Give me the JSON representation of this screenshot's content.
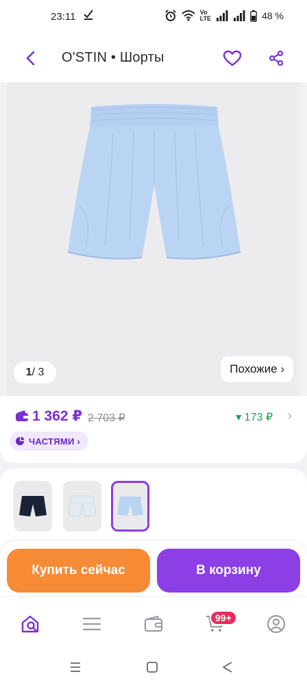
{
  "status_bar": {
    "time": "23:11",
    "check_icon": "check-download-icon",
    "battery_percent": "48 %",
    "network_label_top": "Vo",
    "network_label_bottom": "LTE"
  },
  "header": {
    "title": "O'STIN • Шорты",
    "back_icon": "chevron-left-icon",
    "favorite_icon": "heart-icon",
    "share_icon": "share-icon",
    "accent_color": "#7b2fd6"
  },
  "gallery": {
    "current_page": "1",
    "total_pages": "3",
    "page_separator": "/",
    "similar_label": "Похожие ›",
    "product_color": "#b9d3f2"
  },
  "price": {
    "current": "1 362 ₽",
    "old": "2 703 ₽",
    "cashback": "▾ 173 ₽",
    "installments_label": "ЧАСТЯМИ ›",
    "price_color": "#7b2fd6",
    "cashback_color": "#1a9e52"
  },
  "variants": [
    {
      "name": "dark",
      "color": "#1b2233",
      "selected": false
    },
    {
      "name": "white",
      "color": "#e4ebf0",
      "selected": false
    },
    {
      "name": "blue",
      "color": "#b9d3f2",
      "selected": true
    }
  ],
  "actions": {
    "buy_now_label": "Купить сейчас",
    "add_to_cart_label": "В корзину",
    "buy_color": "#f68a35",
    "cart_color": "#8b3fe5"
  },
  "bottom_nav": {
    "items": [
      "home-search-icon",
      "catalog-icon",
      "wallet-icon",
      "cart-icon",
      "profile-icon"
    ],
    "cart_badge": "99+"
  }
}
